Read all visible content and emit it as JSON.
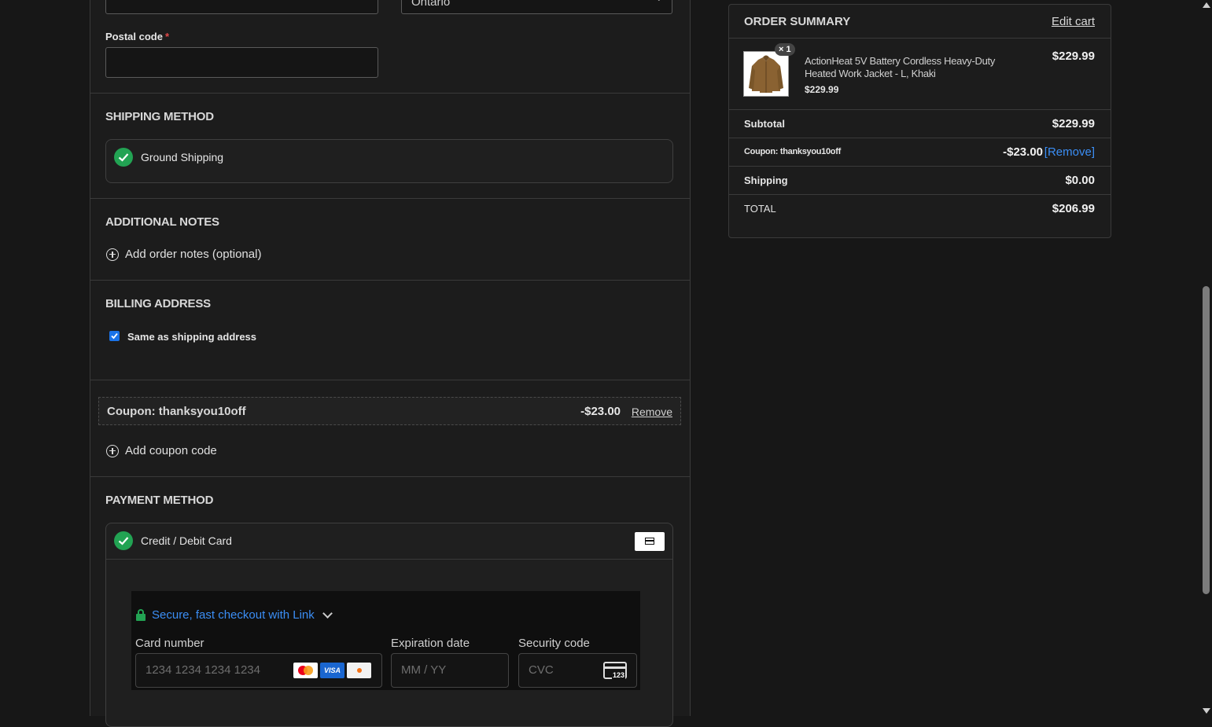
{
  "address": {
    "province_value": "Ontario",
    "postal_code_label": "Postal code",
    "required_mark": "*",
    "postal_code_value": ""
  },
  "shipping": {
    "title": "SHIPPING METHOD",
    "option_label": "Ground Shipping"
  },
  "notes": {
    "title": "ADDITIONAL NOTES",
    "add_link": "Add order notes (optional)"
  },
  "billing": {
    "title": "BILLING ADDRESS",
    "same_label": "Same as shipping address",
    "same_checked": true
  },
  "coupon": {
    "label": "Coupon: thanksyou10off",
    "amount": "-$23.00",
    "remove_label": "Remove",
    "add_link": "Add coupon code"
  },
  "payment": {
    "title": "PAYMENT METHOD",
    "option_label": "Credit / Debit Card",
    "link_text": "Secure, fast checkout with Link",
    "card_number_label": "Card number",
    "card_number_placeholder": "1234 1234 1234 1234",
    "expiry_label": "Expiration date",
    "expiry_placeholder": "MM / YY",
    "cvc_label": "Security code",
    "cvc_placeholder": "CVC",
    "card_brands": [
      "mastercard-icon",
      "visa-icon",
      "discover-icon"
    ],
    "cvc_icon_text": "123"
  },
  "summary": {
    "title": "ORDER SUMMARY",
    "edit_cart": "Edit cart",
    "item": {
      "qty_badge": "× 1",
      "name": "ActionHeat 5V Battery Cordless Heavy-Duty Heated Work Jacket - L, Khaki",
      "unit_price": "$229.99",
      "line_total": "$229.99"
    },
    "subtotal_label": "Subtotal",
    "subtotal_value": "$229.99",
    "coupon_label": "Coupon: thanksyou10off",
    "coupon_value": "-$23.00",
    "coupon_remove": "[Remove]",
    "shipping_label": "Shipping",
    "shipping_value": "$0.00",
    "total_label": "TOTAL",
    "total_value": "$206.99"
  },
  "colors": {
    "accent_green": "#22a353",
    "link_blue": "#3b8ef5",
    "checkbox_blue": "#1a73e8"
  }
}
